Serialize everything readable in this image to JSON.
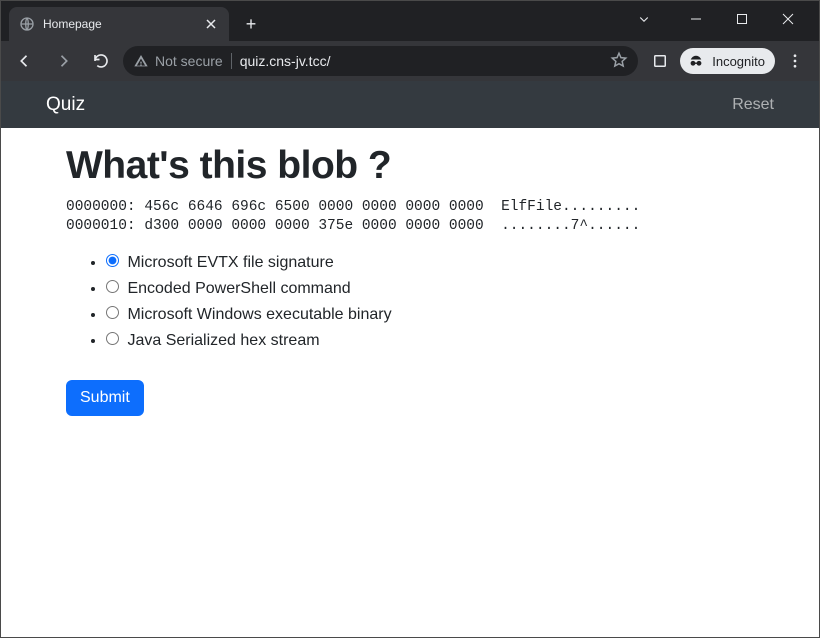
{
  "browser": {
    "tab_title": "Homepage",
    "not_secure_label": "Not secure",
    "url": "quiz.cns-jv.tcc/",
    "incognito_label": "Incognito"
  },
  "page": {
    "brand": "Quiz",
    "reset_label": "Reset",
    "question_title": "What's this blob ?",
    "hex_dump": "0000000: 456c 6646 696c 6500 0000 0000 0000 0000  ElfFile.........\n0000010: d300 0000 0000 0000 375e 0000 0000 0000  ........7^......",
    "options": [
      {
        "label": "Microsoft EVTX file signature",
        "selected": true
      },
      {
        "label": "Encoded PowerShell command",
        "selected": false
      },
      {
        "label": "Microsoft Windows executable binary",
        "selected": false
      },
      {
        "label": "Java Serialized hex stream",
        "selected": false
      }
    ],
    "submit_label": "Submit"
  }
}
